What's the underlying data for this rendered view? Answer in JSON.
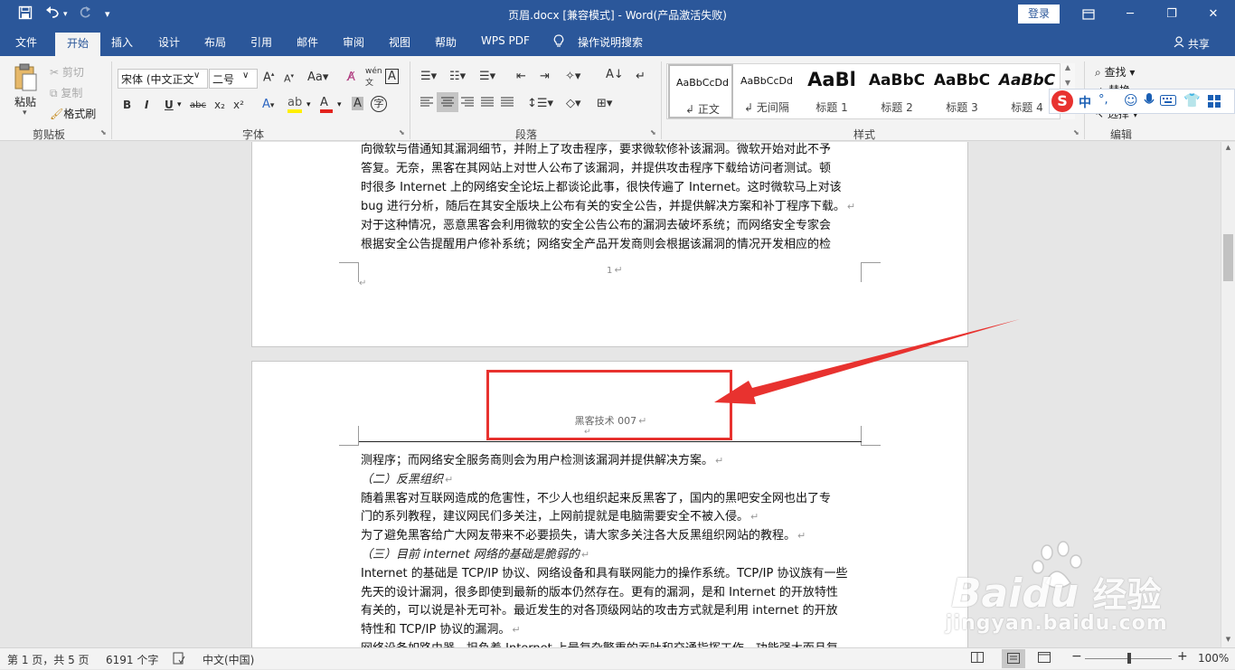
{
  "window": {
    "title": "页眉.docx [兼容模式]  -  Word(产品激活失败)",
    "login": "登录",
    "ribbon_display_icon": "ribbon-display-icon",
    "minimize": "─",
    "restore": "❐",
    "close": "✕"
  },
  "quick_access": {
    "save_icon": "save-icon",
    "undo_icon": "undo-icon",
    "redo_icon": "redo-icon",
    "customize_icon": "customize-icon"
  },
  "tabs": [
    "文件",
    "开始",
    "插入",
    "设计",
    "布局",
    "引用",
    "邮件",
    "审阅",
    "视图",
    "帮助",
    "WPS PDF",
    "操作说明搜索"
  ],
  "active_tab": "开始",
  "share": "共享",
  "clipboard": {
    "paste": "粘贴",
    "cut": "剪切",
    "copy": "复制",
    "format_painter": "格式刷",
    "label": "剪贴板"
  },
  "font": {
    "name": "宋体 (中文正文)",
    "size": "二号",
    "label": "字体",
    "bold": "B",
    "italic": "I",
    "underline": "U",
    "strike": "abc",
    "sub": "x₂",
    "sup": "x²",
    "grow": "A",
    "shrink": "A",
    "case": "Aa",
    "clear": "A",
    "phonetic": "wén",
    "border": "A"
  },
  "paragraph": {
    "label": "段落"
  },
  "styles": {
    "label": "样式",
    "items": [
      {
        "preview": "AaBbCcDd",
        "name": "正文"
      },
      {
        "preview": "AaBbCcDd",
        "name": "无间隔"
      },
      {
        "preview": "AaBl",
        "name": "标题 1"
      },
      {
        "preview": "AaBbC",
        "name": "标题 2"
      },
      {
        "preview": "AaBbC",
        "name": "标题 3"
      },
      {
        "preview": "AaBbC",
        "name": "标题 4"
      }
    ]
  },
  "editing": {
    "find": "查找",
    "replace": "替换",
    "select": "选择",
    "label": "编辑"
  },
  "ime": {
    "mode": "中",
    "punct": "°,",
    "icons": [
      "sogou-logo-icon",
      "emoji-icon",
      "mic-icon",
      "keyboard-icon",
      "skin-icon",
      "toolbox-icon"
    ]
  },
  "page1": {
    "lines": [
      "向微软与借通知其漏洞细节，并附上了攻击程序，要求微软修补该漏洞。微软开始对此不予",
      "答复。无奈，黑客在其网站上对世人公布了该漏洞，并提供攻击程序下载给访问者测试。顿",
      "时很多 Internet 上的网络安全论坛上都谈论此事，很快传遍了 Internet。这时微软马上对该",
      "bug 进行分析，随后在其安全版块上公布有关的安全公告，并提供解决方案和补丁程序下载。",
      "对于这种情况，恶意黑客会利用微软的安全公告公布的漏洞去破坏系统；而网络安全专家会",
      "根据安全公告提醒用户修补系统；网络安全产品开发商则会根据该漏洞的情况开发相应的检"
    ],
    "footer_page_number": "1"
  },
  "page2": {
    "header_text": "黑客技术 007",
    "lines": [
      {
        "text": "测程序；而网络安全服务商则会为用户检测该漏洞并提供解决方案。",
        "italic": false
      },
      {
        "text": "（二）反黑组织",
        "italic": true
      },
      {
        "text": "随着黑客对互联网造成的危害性，不少人也组织起来反黑客了，国内的黑吧安全网也出了专",
        "italic": false
      },
      {
        "text": "门的系列教程，建议网民们多关注，上网前提就是电脑需要安全不被入侵。",
        "italic": false
      },
      {
        "text": "为了避免黑客给广大网友带来不必要损失，请大家多关注各大反黑组织网站的教程。",
        "italic": false
      },
      {
        "text": "（三）目前 internet 网络的基础是脆弱的",
        "italic": true
      },
      {
        "text": "Internet 的基础是 TCP/IP 协议、网络设备和具有联网能力的操作系统。TCP/IP 协议族有一些",
        "italic": false
      },
      {
        "text": "先天的设计漏洞，很多即使到最新的版本仍然存在。更有的漏洞，是和 Internet 的开放特性",
        "italic": false
      },
      {
        "text": "有关的，可以说是补无可补。最近发生的对各顶级网站的攻击方式就是利用 internet 的开放",
        "italic": false
      },
      {
        "text": "特性和 TCP/IP 协议的漏洞。",
        "italic": false
      },
      {
        "text": "网络设备如路由器，担负着 Internet 上最复杂繁重的吞吐和交通指挥工作，功能强大而且复",
        "italic": false
      }
    ]
  },
  "annotation": {
    "box_color": "#e8322f",
    "arrow_color": "#e8322f"
  },
  "status": {
    "page": "第 1 页，共 5 页",
    "words": "6191 个字",
    "proof_icon": "proofing-icon",
    "language": "中文(中国)",
    "zoom": "100%",
    "zoom_minus": "−",
    "zoom_plus": "+"
  },
  "watermark": {
    "brand": "Bai",
    "brand_suffix": "经验",
    "url": "jingyan.baidu.com"
  }
}
